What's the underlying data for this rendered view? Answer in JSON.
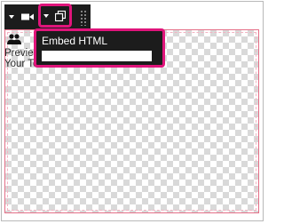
{
  "toolbar": {
    "items": [
      {
        "icon": "caret-down-icon"
      },
      {
        "icon": "video-camera-icon"
      },
      {
        "icon": "caret-down-icon"
      },
      {
        "icon": "embed-copy-icon"
      },
      {
        "icon": "drag-handle-icon"
      }
    ]
  },
  "preview": {
    "icon": "people-icon",
    "line1": "Previe",
    "line2": "Your Teams"
  },
  "embed_popup": {
    "title": "Embed HTML",
    "input_value": "",
    "input_placeholder": ""
  },
  "colors": {
    "toolbar_bg": "#1c1c1c",
    "highlight": "#e0147b",
    "canvas_border": "#e46f87"
  }
}
